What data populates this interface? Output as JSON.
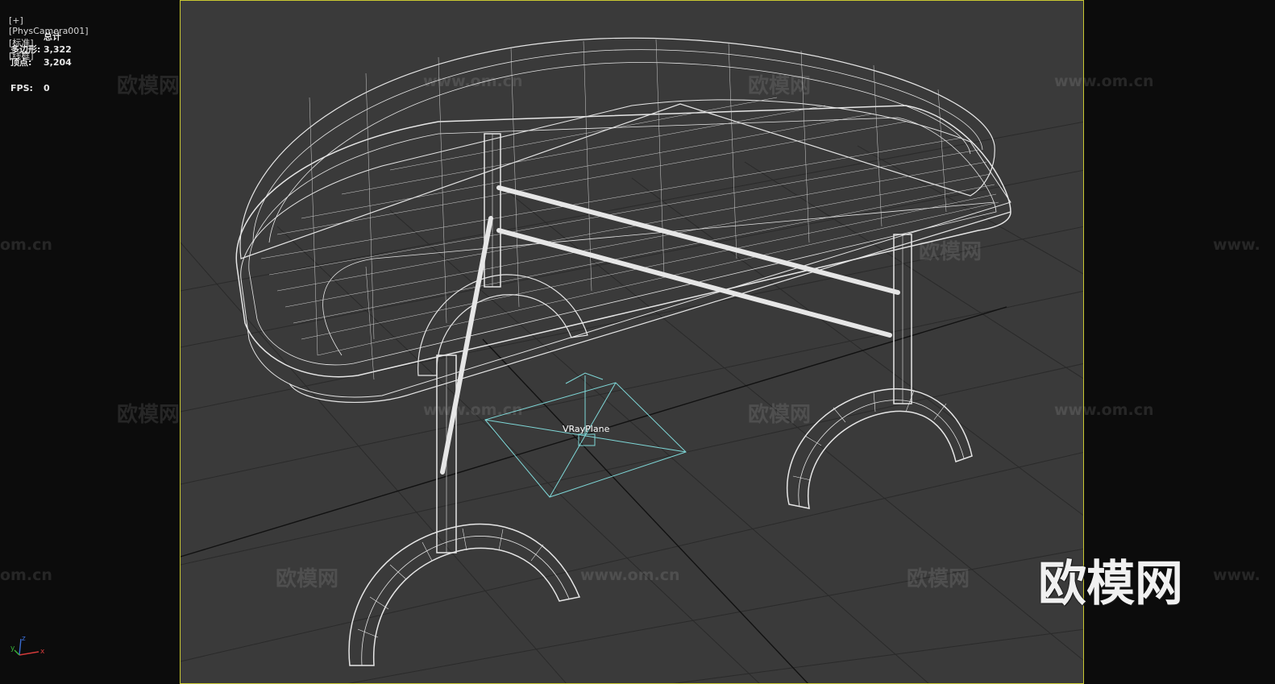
{
  "viewport": {
    "menu": "[+]",
    "camera": "[PhysCamera001]",
    "shading_std": "[标准]",
    "shading_mode": "[线框]"
  },
  "stats": {
    "header": "总计",
    "polygons_label": "多边形:",
    "polygons_value": "3,322",
    "vertices_label": "顶点:",
    "vertices_value": "3,204",
    "fps_label": "FPS:",
    "fps_value": "0"
  },
  "scene": {
    "object_label": "VRayPlane",
    "frame_color": "#c9c832",
    "wire_color": "#e6e6e6",
    "light_color": "#7fd8d8"
  },
  "watermarks": {
    "text": "欧模网",
    "url": "www.om.cn",
    "url_short": "om.cn",
    "url_cut": "www."
  },
  "brand": {
    "text": "欧模网"
  },
  "axes": {
    "x": "x",
    "y": "y",
    "z": "z"
  }
}
